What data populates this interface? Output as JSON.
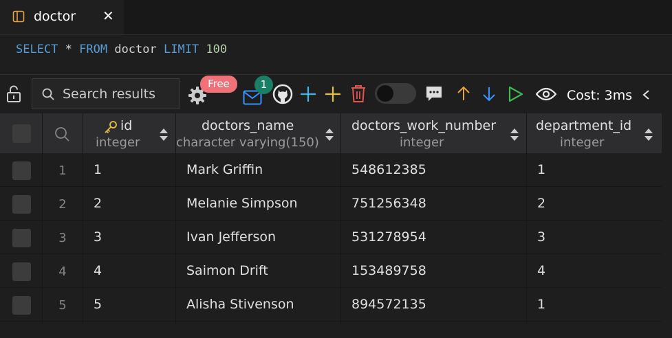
{
  "tab": {
    "label": "doctor",
    "close": "✕"
  },
  "query": {
    "select": "SELECT",
    "star": " * ",
    "from": "FROM",
    "table": " doctor ",
    "limit": "LIMIT",
    "limit_value": " 100"
  },
  "toolbar": {
    "search_placeholder": "Search results",
    "free_badge": "Free",
    "mail_count": "1",
    "cost": "Cost: 3ms"
  },
  "columns": [
    {
      "name": "id",
      "type": "integer",
      "primary_key": true
    },
    {
      "name": "doctors_name",
      "type": "character varying(150)"
    },
    {
      "name": "doctors_work_number",
      "type": "integer"
    },
    {
      "name": "department_id",
      "type": "integer"
    }
  ],
  "rows": [
    {
      "n": "1",
      "id": "1",
      "doctors_name": "Mark Griffin",
      "doctors_work_number": "548612385",
      "department_id": "1"
    },
    {
      "n": "2",
      "id": "2",
      "doctors_name": "Melanie Simpson",
      "doctors_work_number": "751256348",
      "department_id": "2"
    },
    {
      "n": "3",
      "id": "3",
      "doctors_name": "Ivan Jefferson",
      "doctors_work_number": "531278954",
      "department_id": "3"
    },
    {
      "n": "4",
      "id": "4",
      "doctors_name": "Saimon Drift",
      "doctors_work_number": "153489758",
      "department_id": "4"
    },
    {
      "n": "5",
      "id": "5",
      "doctors_name": "Alisha Stivenson",
      "doctors_work_number": "894572135",
      "department_id": "1"
    }
  ],
  "colors": {
    "accent_blue": "#3794ff",
    "add_cyan": "#3fb6e8",
    "add_yellow": "#e2c33b",
    "delete_red": "#e5534b",
    "run_green": "#3fb950",
    "up_orange": "#e8a33b",
    "free_badge": "#f07178",
    "count_badge": "#1a7f64"
  },
  "icons": [
    "file-table-icon",
    "close-icon",
    "unlock-icon",
    "search-icon",
    "gear-icon",
    "mail-icon",
    "github-icon",
    "add-row-icon",
    "add-icon",
    "trash-icon",
    "toggle",
    "comment-icon",
    "arrow-up-icon",
    "arrow-down-icon",
    "run-icon",
    "eye-icon",
    "chevron-left-icon",
    "key-icon",
    "sort-icon"
  ]
}
